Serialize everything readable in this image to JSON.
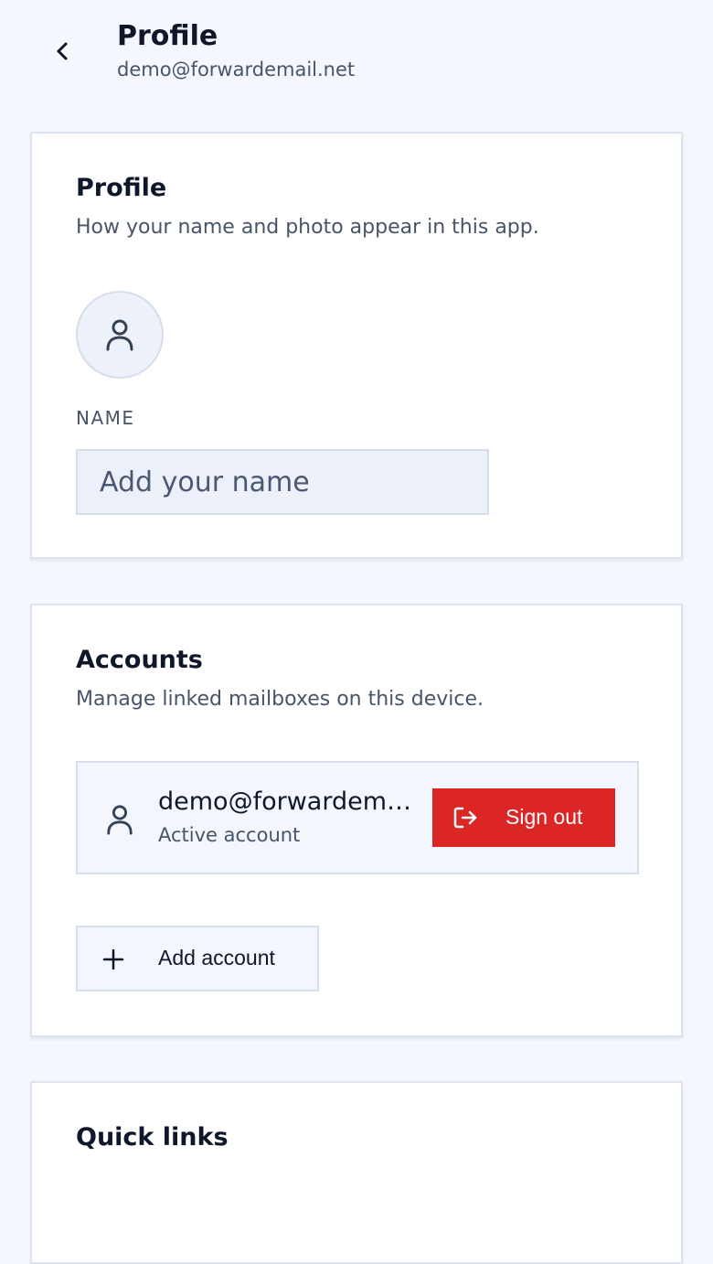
{
  "header": {
    "title": "Profile",
    "subtitle": "demo@forwardemail.net",
    "back_icon": "chevron-left-icon"
  },
  "profile_card": {
    "title": "Profile",
    "description": "How your name and photo appear in this app.",
    "avatar_icon": "user-icon",
    "name_label": "NAME",
    "name_value": "",
    "name_placeholder": "Add your name"
  },
  "accounts_card": {
    "title": "Accounts",
    "description": "Manage linked mailboxes on this device.",
    "accounts": [
      {
        "email": "demo@forwardemail.net",
        "status": "Active account",
        "icon": "user-icon",
        "action_label": "Sign out",
        "action_icon": "sign-out-icon"
      }
    ],
    "add_account_label": "Add account",
    "add_account_icon": "plus-icon"
  },
  "quick_links_card": {
    "title": "Quick links"
  },
  "colors": {
    "background": "#f4f7fd",
    "card": "#ffffff",
    "danger": "#dc2626",
    "text_primary": "#0f172a",
    "text_secondary": "#475569",
    "border": "#d6deeb"
  }
}
